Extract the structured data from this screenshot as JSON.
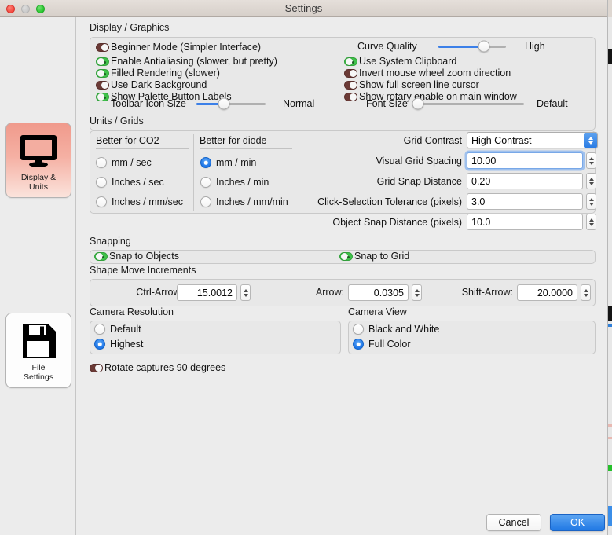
{
  "window": {
    "title": "Settings",
    "traffic_lights": [
      "close-button",
      "minimize-button",
      "zoom-button"
    ]
  },
  "sidebar": {
    "items": [
      {
        "id": "display-units",
        "label_line1": "Display &",
        "label_line2": "Units",
        "icon": "monitor-icon",
        "selected": true
      },
      {
        "id": "file-settings",
        "label_line1": "File",
        "label_line2": "Settings",
        "icon": "floppy-disk-icon",
        "selected": false
      }
    ]
  },
  "display_graphics": {
    "section_label": "Display / Graphics",
    "toggles": [
      {
        "label": "Beginner Mode (Simpler Interface)",
        "on": false
      },
      {
        "label": "Enable Antialiasing (slower, but pretty)",
        "on": true
      },
      {
        "label": "Filled Rendering (slower)",
        "on": true
      },
      {
        "label": "Use Dark Background",
        "on": false
      },
      {
        "label": "Show Palette Button Labels",
        "on": true
      }
    ],
    "right_toggles": [
      {
        "label": "Use System Clipboard",
        "on": true
      },
      {
        "label": "Invert mouse wheel zoom direction",
        "on": false
      },
      {
        "label": "Show full screen line cursor",
        "on": false
      },
      {
        "label": "Show rotary enable on main window",
        "on": false
      }
    ],
    "sliders": [
      {
        "id": "toolbar-icon-size",
        "label": "Toolbar Icon Size",
        "value_label": "Normal",
        "percent": 40,
        "filled": true
      },
      {
        "id": "curve-quality",
        "label": "Curve Quality",
        "value_label": "High",
        "percent": 68,
        "filled": true
      },
      {
        "id": "font-size",
        "label": "Font Size",
        "value_label": "Default",
        "percent": 0,
        "filled": false
      }
    ]
  },
  "units_grids": {
    "section_label": "Units / Grids",
    "columns": [
      {
        "header": "Better for CO2",
        "options": [
          {
            "label": "mm / sec",
            "selected": false
          },
          {
            "label": "Inches / sec",
            "selected": false
          },
          {
            "label": "Inches / mm/sec",
            "selected": false
          }
        ]
      },
      {
        "header": "Better for diode",
        "options": [
          {
            "label": "mm / min",
            "selected": true
          },
          {
            "label": "Inches / min",
            "selected": false
          },
          {
            "label": "Inches / mm/min",
            "selected": false
          }
        ]
      }
    ],
    "fields": [
      {
        "id": "grid-contrast",
        "label": "Grid Contrast",
        "value": "High Contrast",
        "type": "combo",
        "focused": false
      },
      {
        "id": "visual-grid-spacing",
        "label": "Visual Grid Spacing",
        "value": "10.00",
        "type": "stepper",
        "focused": true
      },
      {
        "id": "grid-snap-distance",
        "label": "Grid Snap Distance",
        "value": "0.20",
        "type": "stepper",
        "focused": false
      },
      {
        "id": "click-selection-tolerance",
        "label": "Click-Selection Tolerance (pixels)",
        "value": "3.0",
        "type": "stepper",
        "focused": false
      },
      {
        "id": "object-snap-distance",
        "label": "Object Snap Distance (pixels)",
        "value": "10.0",
        "type": "stepper",
        "focused": false
      }
    ]
  },
  "snapping": {
    "section_label": "Snapping",
    "toggles": [
      {
        "label": "Snap to Objects",
        "on": true
      },
      {
        "label": "Snap to Grid",
        "on": true
      }
    ],
    "increments_label": "Shape Move Increments",
    "increments": [
      {
        "id": "ctrl-arrow",
        "label": "Ctrl-Arrow:",
        "value": "15.0012"
      },
      {
        "id": "arrow",
        "label": "Arrow:",
        "value": "0.0305"
      },
      {
        "id": "shift-arrow",
        "label": "Shift-Arrow:",
        "value": "20.0000"
      }
    ]
  },
  "camera_resolution": {
    "section_label": "Camera Resolution",
    "options": [
      {
        "label": "Default",
        "selected": false
      },
      {
        "label": "Highest",
        "selected": true
      }
    ]
  },
  "camera_view": {
    "section_label": "Camera View",
    "options": [
      {
        "label": "Black and White",
        "selected": false
      },
      {
        "label": "Full Color",
        "selected": true
      }
    ]
  },
  "rotate_captures": {
    "label": "Rotate captures 90 degrees",
    "on": false
  },
  "footer": {
    "cancel_label": "Cancel",
    "ok_label": "OK"
  },
  "colors": {
    "accent_blue": "#2078e4",
    "toggle_on": "#3fc24a",
    "toggle_off": "#6b3a36",
    "focus_ring": "#78a8e8",
    "selected_rail": "#f09a8c"
  }
}
